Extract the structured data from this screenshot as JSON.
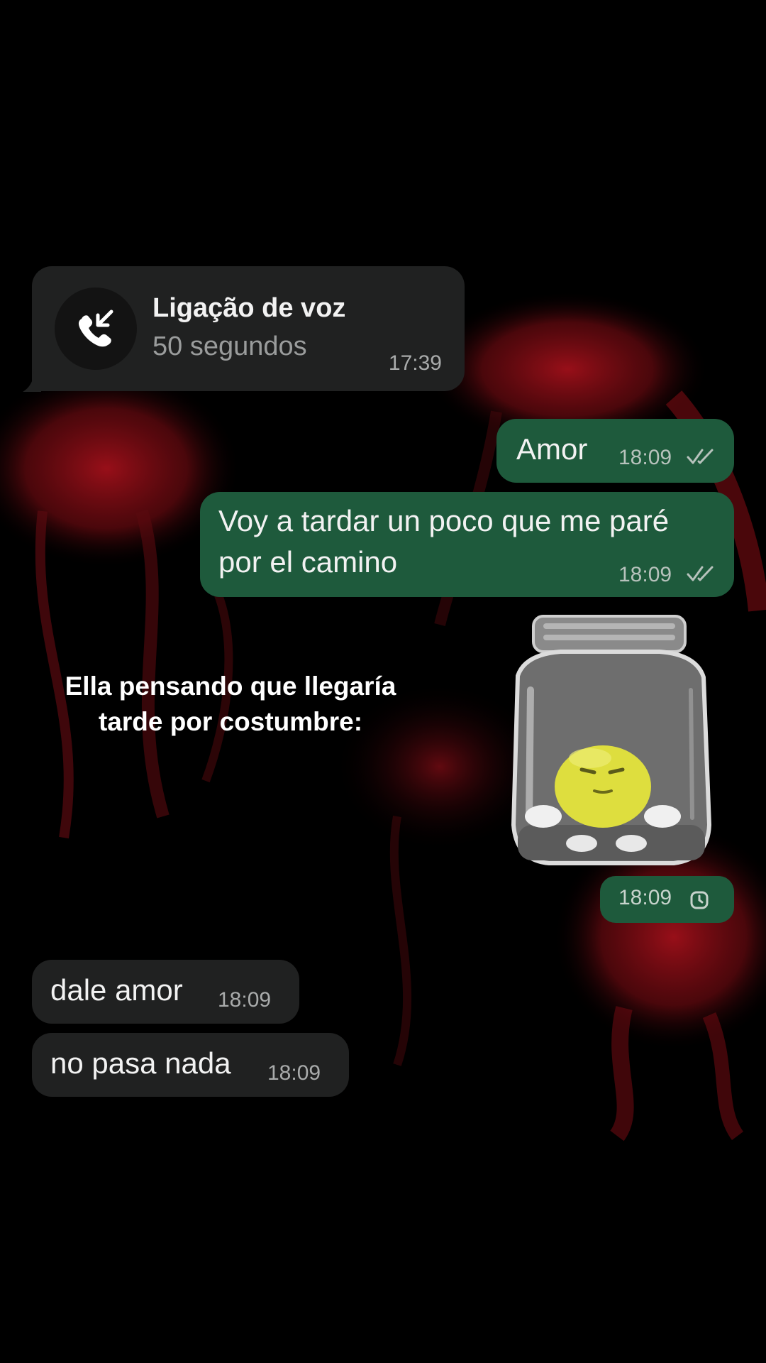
{
  "call": {
    "title": "Ligação de voz",
    "duration": "50 segundos",
    "time": "17:39",
    "icon": "incoming-call-icon"
  },
  "messages": [
    {
      "direction": "out",
      "text": "Amor",
      "time": "18:09",
      "status": "read"
    },
    {
      "direction": "out",
      "text_line1": "Voy a tardar un poco que me paré",
      "text_line2": "por el camino",
      "time": "18:09",
      "status": "read"
    },
    {
      "direction": "out",
      "type": "sticker",
      "sticker": "emoji-in-jar-sticker",
      "time": "18:09",
      "status": "pending"
    },
    {
      "direction": "in",
      "text": "dale amor",
      "time": "18:09"
    },
    {
      "direction": "in",
      "text": "no pasa nada",
      "time": "18:09"
    }
  ],
  "caption": {
    "line1": "Ella pensando que llegaría",
    "line2": "tarde por costumbre:"
  },
  "colors": {
    "background": "#000000",
    "incoming_bubble": "#202121",
    "outgoing_bubble": "#1e5a3c",
    "accent_red": "#8a0d12"
  }
}
